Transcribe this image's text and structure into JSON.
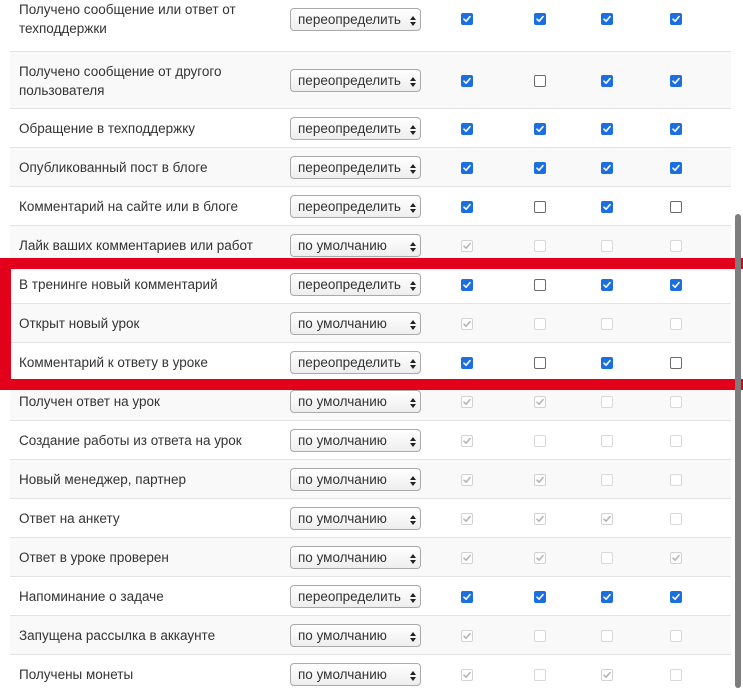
{
  "select_options": {
    "override": "переопределить",
    "default": "по умолчанию"
  },
  "rows": [
    {
      "label": "Получено сообщение или ответ от техподдержки",
      "mode": "override",
      "checks": [
        "on",
        "on",
        "on",
        "on"
      ]
    },
    {
      "label": "Получено сообщение от другого пользователя",
      "mode": "override",
      "checks": [
        "on",
        "off",
        "on",
        "on"
      ]
    },
    {
      "label": "Обращение в техподдержку",
      "mode": "override",
      "checks": [
        "on",
        "on",
        "on",
        "on"
      ]
    },
    {
      "label": "Опубликованный пост в блоге",
      "mode": "override",
      "checks": [
        "on",
        "on",
        "on",
        "on"
      ]
    },
    {
      "label": "Комментарий на сайте или в блоге",
      "mode": "override",
      "checks": [
        "on",
        "off",
        "on",
        "off"
      ]
    },
    {
      "label": "Лайк ваших комментариев или работ",
      "mode": "default",
      "checks": [
        "don",
        "doff",
        "doff",
        "doff"
      ]
    },
    {
      "label": "В тренинге новый комментарий",
      "mode": "override",
      "checks": [
        "on",
        "off",
        "on",
        "on"
      ]
    },
    {
      "label": "Открыт новый урок",
      "mode": "default",
      "checks": [
        "don",
        "doff",
        "doff",
        "doff"
      ]
    },
    {
      "label": "Комментарий к ответу в уроке",
      "mode": "override",
      "checks": [
        "on",
        "off",
        "on",
        "off"
      ]
    },
    {
      "label": "Получен ответ на урок",
      "mode": "default",
      "checks": [
        "don",
        "don",
        "doff",
        "doff"
      ]
    },
    {
      "label": "Создание работы из ответа на урок",
      "mode": "default",
      "checks": [
        "don",
        "doff",
        "doff",
        "doff"
      ]
    },
    {
      "label": "Новый менеджер, партнер",
      "mode": "default",
      "checks": [
        "don",
        "don",
        "doff",
        "doff"
      ]
    },
    {
      "label": "Ответ на анкету",
      "mode": "default",
      "checks": [
        "don",
        "don",
        "don",
        "doff"
      ]
    },
    {
      "label": "Ответ в уроке проверен",
      "mode": "default",
      "checks": [
        "don",
        "don",
        "doff",
        "don"
      ]
    },
    {
      "label": "Напоминание о задаче",
      "mode": "override",
      "checks": [
        "on",
        "on",
        "on",
        "on"
      ]
    },
    {
      "label": "Запущена рассылка в аккаунте",
      "mode": "default",
      "checks": [
        "don",
        "doff",
        "doff",
        "doff"
      ]
    },
    {
      "label": "Получены монеты",
      "mode": "default",
      "checks": [
        "don",
        "doff",
        "don",
        "doff"
      ]
    }
  ],
  "colors": {
    "checkbox_on": "#1b6fe0",
    "highlight": "#e3001b"
  },
  "icons": {
    "select_arrows": "updown-arrows-icon",
    "check": "checkmark-icon"
  }
}
